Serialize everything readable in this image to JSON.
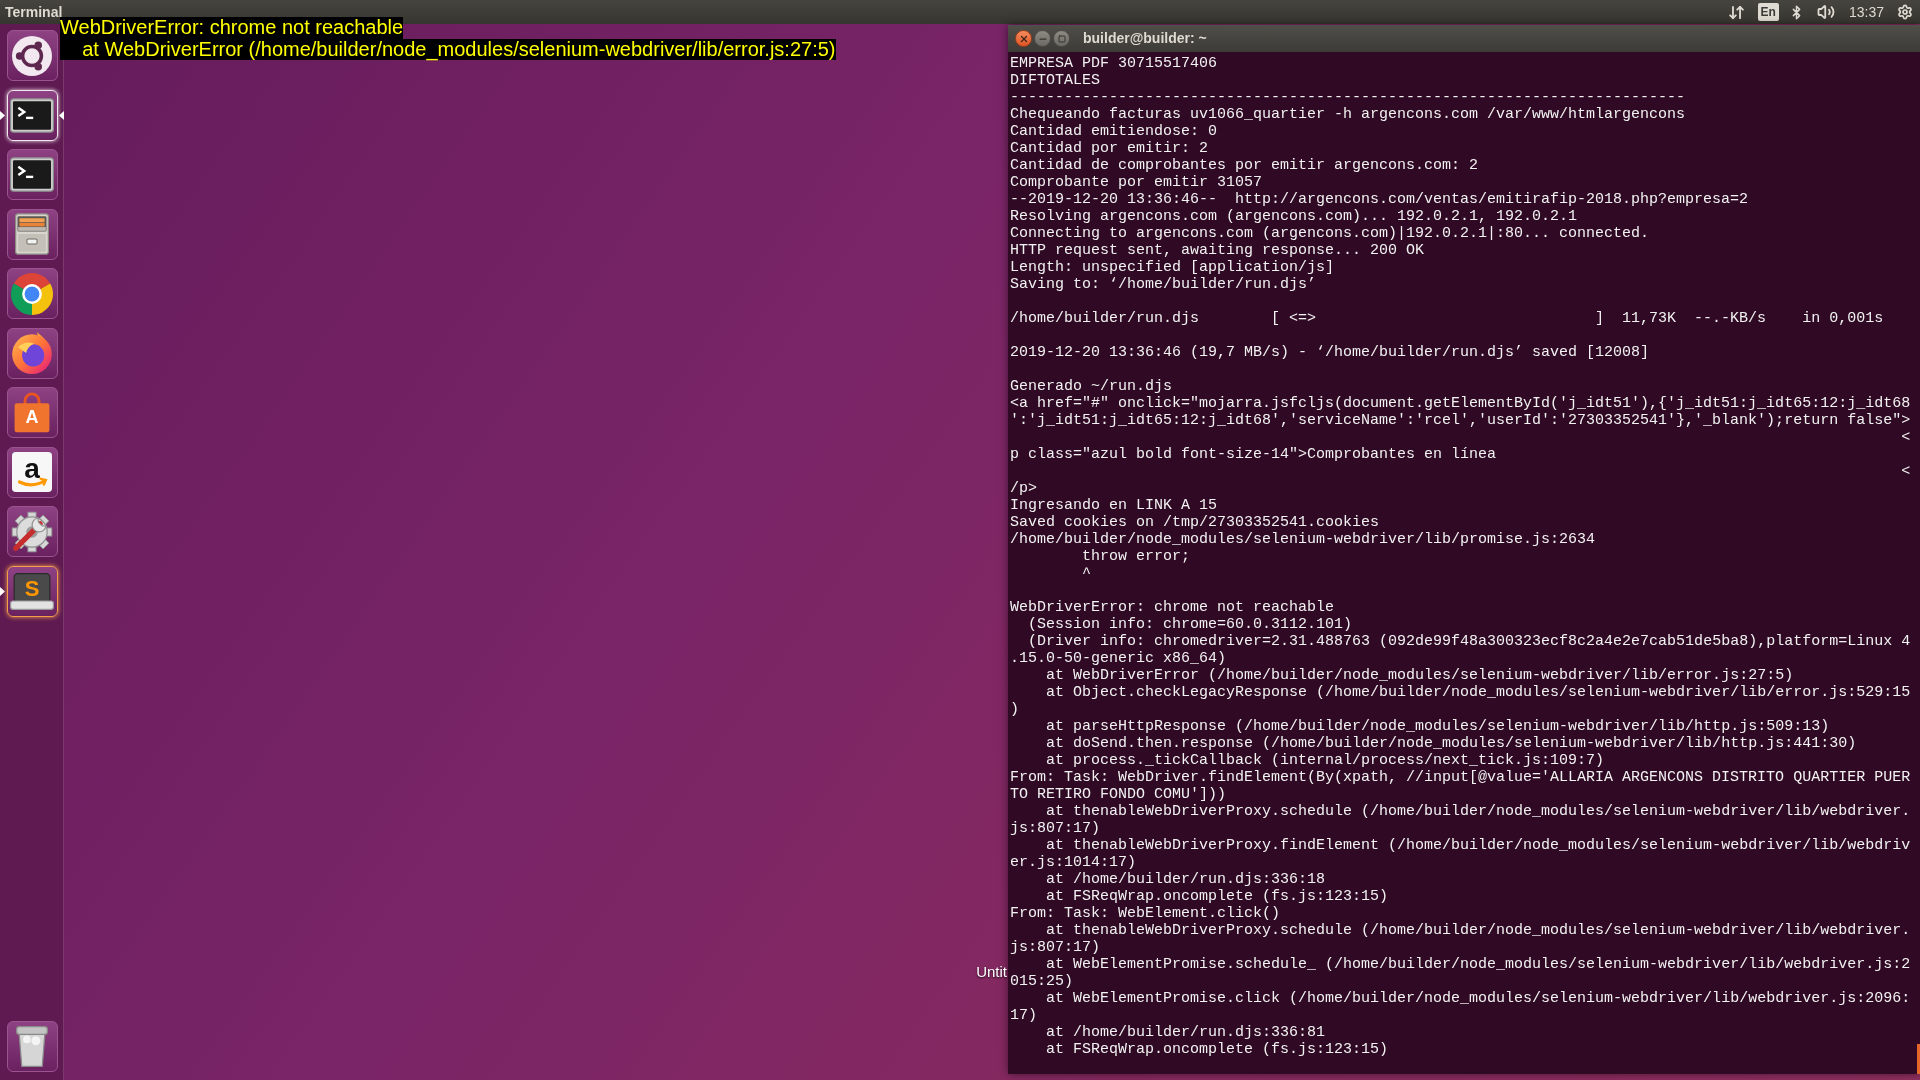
{
  "top_panel": {
    "app_name": "Terminal",
    "keyboard_layout": "En",
    "clock": "13:37"
  },
  "notification": {
    "lines": [
      "WebDriverError: chrome not reachable",
      "    at WebDriverError (/home/builder/node_modules/selenium-webdriver/lib/error.js:27:5)"
    ]
  },
  "launcher": {
    "items": [
      {
        "kind": "home",
        "running": false,
        "focused": false,
        "highlighted": false
      },
      {
        "kind": "terminal",
        "running": true,
        "focused": true,
        "highlighted": false
      },
      {
        "kind": "terminal",
        "running": false,
        "focused": false,
        "highlighted": false
      },
      {
        "kind": "files",
        "running": false,
        "focused": false,
        "highlighted": false
      },
      {
        "kind": "chrome",
        "running": false,
        "focused": false,
        "highlighted": false
      },
      {
        "kind": "firefox",
        "running": false,
        "focused": false,
        "highlighted": false
      },
      {
        "kind": "store",
        "glyph": "A",
        "running": false,
        "focused": false,
        "highlighted": false
      },
      {
        "kind": "amazon",
        "glyph": "a",
        "running": false,
        "focused": false,
        "highlighted": false
      },
      {
        "kind": "settings",
        "running": false,
        "focused": false,
        "highlighted": false
      },
      {
        "kind": "editor",
        "glyph": "S",
        "running": true,
        "focused": false,
        "highlighted": true
      },
      {
        "kind": "trash",
        "running": false,
        "focused": false,
        "highlighted": false
      }
    ]
  },
  "desktop": {
    "icon_label": "Untit"
  },
  "terminal": {
    "title": "builder@builder: ~",
    "blocks": [
      [
        "EMPRESA PDF 30715517406",
        "DIFTOTALES",
        "---------------------------------------------------------------------------",
        "Chequeando facturas uv1066_quartier -h argencons.com /var/www/htmlargencons",
        "Cantidad emitiendose: 0",
        "Cantidad por emitir: 2",
        "Cantidad de comprobantes por emitir argencons.com: 2",
        "Comprobante por emitir 31057",
        "--2019-12-20 13:36:46--  http://argencons.com/ventas/emitirafip-2018.php?empresa=2",
        "Resolving argencons.com (argencons.com)... 192.0.2.1, 192.0.2.1",
        "Connecting to argencons.com (argencons.com)|192.0.2.1|:80... connected.",
        "HTTP request sent, awaiting response... 200 OK",
        "Length: unspecified [application/js]",
        "Saving to: ‘/home/builder/run.djs’"
      ],
      [
        "/home/builder/run.djs        [ <=>                               ]  11,73K  --.-KB/s    in 0,001s"
      ],
      [
        "2019-12-20 13:36:46 (19,7 MB/s) - ‘/home/builder/run.djs’ saved [12008]"
      ],
      [
        "Generado ~/run.djs",
        "<a href=\"#\" onclick=\"mojarra.jsfcljs(document.getElementById('j_idt51'),{'j_idt51:j_idt65:12:j_idt68",
        "':'j_idt51:j_idt65:12:j_idt68','serviceName':'rcel','userId':'27303352541'},'_blank');return false\">",
        "                                                                                                   <",
        "p class=\"azul bold font-size-14\">Comprobantes en línea",
        "                                                                                                   <",
        "/p>",
        "Ingresando en LINK A 15",
        "Saved cookies on /tmp/27303352541.cookies",
        "/home/builder/node_modules/selenium-webdriver/lib/promise.js:2634",
        "        throw error;",
        "        ^"
      ],
      [
        "WebDriverError: chrome not reachable",
        "  (Session info: chrome=60.0.3112.101)",
        "  (Driver info: chromedriver=2.31.488763 (092de99f48a300323ecf8c2a4e2e7cab51de5ba8),platform=Linux 4",
        ".15.0-50-generic x86_64)",
        "    at WebDriverError (/home/builder/node_modules/selenium-webdriver/lib/error.js:27:5)",
        "    at Object.checkLegacyResponse (/home/builder/node_modules/selenium-webdriver/lib/error.js:529:15",
        ")",
        "    at parseHttpResponse (/home/builder/node_modules/selenium-webdriver/lib/http.js:509:13)",
        "    at doSend.then.response (/home/builder/node_modules/selenium-webdriver/lib/http.js:441:30)",
        "    at process._tickCallback (internal/process/next_tick.js:109:7)",
        "From: Task: WebDriver.findElement(By(xpath, //input[@value='ALLARIA ARGENCONS DISTRITO QUARTIER PUER",
        "TO RETIRO FONDO COMU']))",
        "    at thenableWebDriverProxy.schedule (/home/builder/node_modules/selenium-webdriver/lib/webdriver.",
        "js:807:17)",
        "    at thenableWebDriverProxy.findElement (/home/builder/node_modules/selenium-webdriver/lib/webdriv",
        "er.js:1014:17)",
        "    at /home/builder/run.djs:336:18",
        "    at FSReqWrap.oncomplete (fs.js:123:15)",
        "From: Task: WebElement.click()",
        "    at thenableWebDriverProxy.schedule (/home/builder/node_modules/selenium-webdriver/lib/webdriver.",
        "js:807:17)",
        "    at WebElementPromise.schedule_ (/home/builder/node_modules/selenium-webdriver/lib/webdriver.js:2",
        "015:25)",
        "    at WebElementPromise.click (/home/builder/node_modules/selenium-webdriver/lib/webdriver.js:2096:",
        "17)",
        "    at /home/builder/run.djs:336:81",
        "    at FSReqWrap.oncomplete (fs.js:123:15)"
      ]
    ]
  }
}
